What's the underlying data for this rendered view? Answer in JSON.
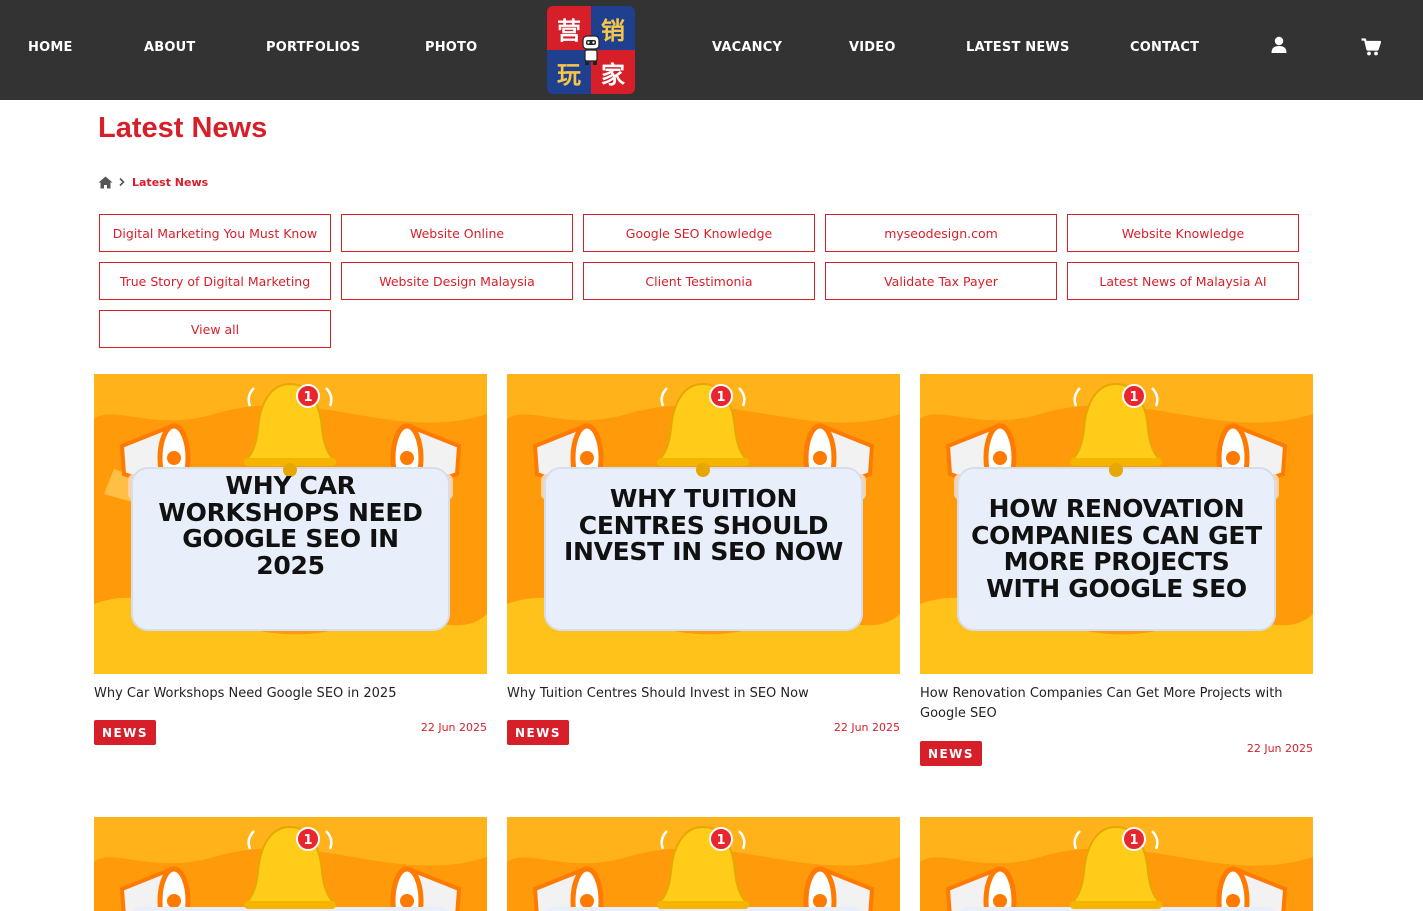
{
  "nav": {
    "home": "HOME",
    "about": "ABOUT",
    "portfolios": "PORTFOLIOS",
    "photo": "PHOTO",
    "vacancy": "VACANCY",
    "video": "VIDEO",
    "latest_news": "LATEST NEWS",
    "contact": "CONTACT"
  },
  "logo": {
    "chars": [
      "营",
      "销",
      "玩",
      "家"
    ]
  },
  "icons": {
    "account": "user-icon",
    "cart": "cart-icon",
    "home": "home-icon"
  },
  "page_title": "Latest News",
  "breadcrumb": {
    "current": "Latest News"
  },
  "categories": [
    "Digital Marketing You Must Know",
    "Website Online",
    "Google SEO Knowledge",
    "myseodesign.com",
    "Website Knowledge",
    "True Story of Digital Marketing",
    "Website Design Malaysia",
    "Client Testimonia",
    "Validate Tax Payer",
    "Latest News of Malaysia AI",
    "View all"
  ],
  "cards": [
    {
      "image_text": "WHY CAR WORKSHOPS NEED GOOGLE SEO IN 2025",
      "title": "Why Car Workshops Need Google SEO in 2025",
      "badge": "NEWS",
      "date": "22 Jun 2025"
    },
    {
      "image_text": "WHY TUITION CENTRES SHOULD INVEST IN SEO NOW",
      "title": "Why Tuition Centres Should Invest in SEO Now",
      "badge": "NEWS",
      "date": "22 Jun 2025"
    },
    {
      "image_text": "HOW RENOVATION COMPANIES CAN GET MORE PROJECTS WITH GOOGLE SEO",
      "title": "How Renovation Companies Can Get More Projects with Google SEO",
      "badge": "NEWS",
      "date": "22 Jun 2025"
    }
  ],
  "notification_count": "1",
  "colors": {
    "header_bg": "#333333",
    "accent": "#d71f2a",
    "banner_orange": "#ff9a0a",
    "banner_yellow": "#ffc21a"
  }
}
